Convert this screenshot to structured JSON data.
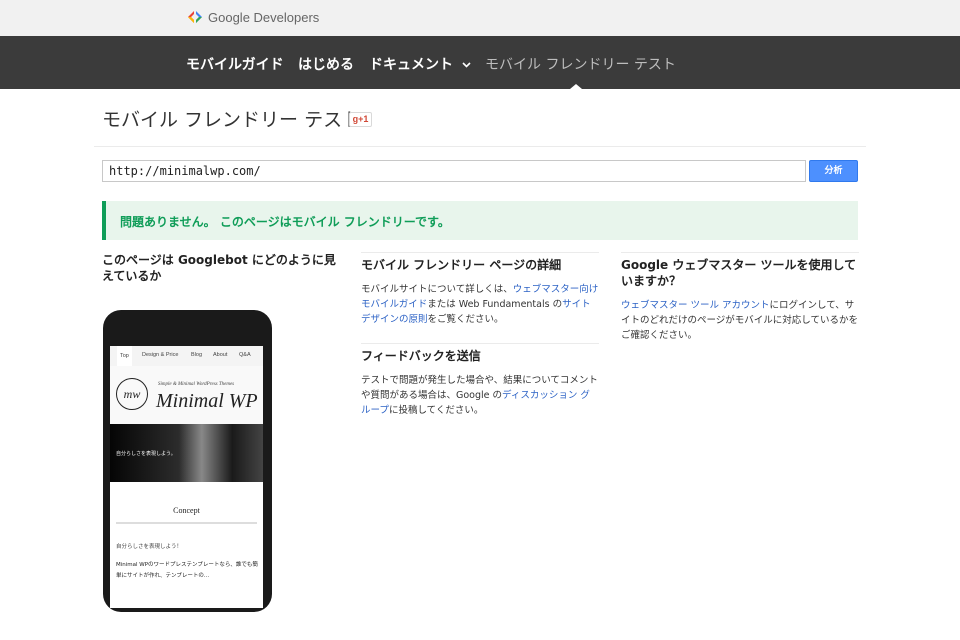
{
  "header": {
    "brand": "Google Developers"
  },
  "nav": {
    "items": [
      {
        "label": "モバイルガイド"
      },
      {
        "label": "はじめる"
      },
      {
        "label": "ドキュメント"
      },
      {
        "label": "モバイル フレンドリー テスト"
      }
    ]
  },
  "page": {
    "title": "モバイル フレンドリー テスト",
    "gplus": "+1"
  },
  "form": {
    "url": "http://minimalwp.com/",
    "analyze_label": "分析"
  },
  "result": {
    "text": "問題ありません。 このページはモバイル フレンドリーです。"
  },
  "left": {
    "heading": "このページは Googlebot にどのように見えているか"
  },
  "details": {
    "heading": "モバイル フレンドリー ページの詳細",
    "p1": "モバイルサイトについて詳しくは、",
    "link1": "ウェブマスター向けモバイルガイド",
    "p2": "または Web Fundamentals の",
    "link2": "サイトデザインの原則",
    "p3": "をご覧ください。"
  },
  "feedback": {
    "heading": "フィードバックを送信",
    "p1": "テストで問題が発生した場合や、結果についてコメントや質問がある場合は、Google の",
    "link1": "ディスカッション グループ",
    "p2": "に投稿してください。"
  },
  "webmaster": {
    "heading": "Google ウェブマスター ツールを使用していますか？",
    "link1": "ウェブマスター ツール アカウント",
    "p1": "にログインして、サイトのどれだけのページがモバイルに対応しているかをご確認ください。"
  },
  "preview": {
    "tabs": [
      "Top",
      "Design & Price",
      "Blog",
      "About",
      "Q&A"
    ],
    "logo": "mw",
    "tagline": "Simple & Minimal WordPress Themes",
    "brand": "Minimal WP",
    "hero_text": "自分らしさを表現しよう。",
    "section": "Concept",
    "subtitle": "自分らしさを表現しよう！",
    "body": "Minimal WPのワードプレステンプレートなら、誰でも簡単にサイトが作れ、テンプレートの..."
  },
  "colors": {
    "navbar": "#3b3b3b",
    "accent_blue": "#4d90fe",
    "success_green": "#0f9d58",
    "link": "#2c62c5"
  }
}
